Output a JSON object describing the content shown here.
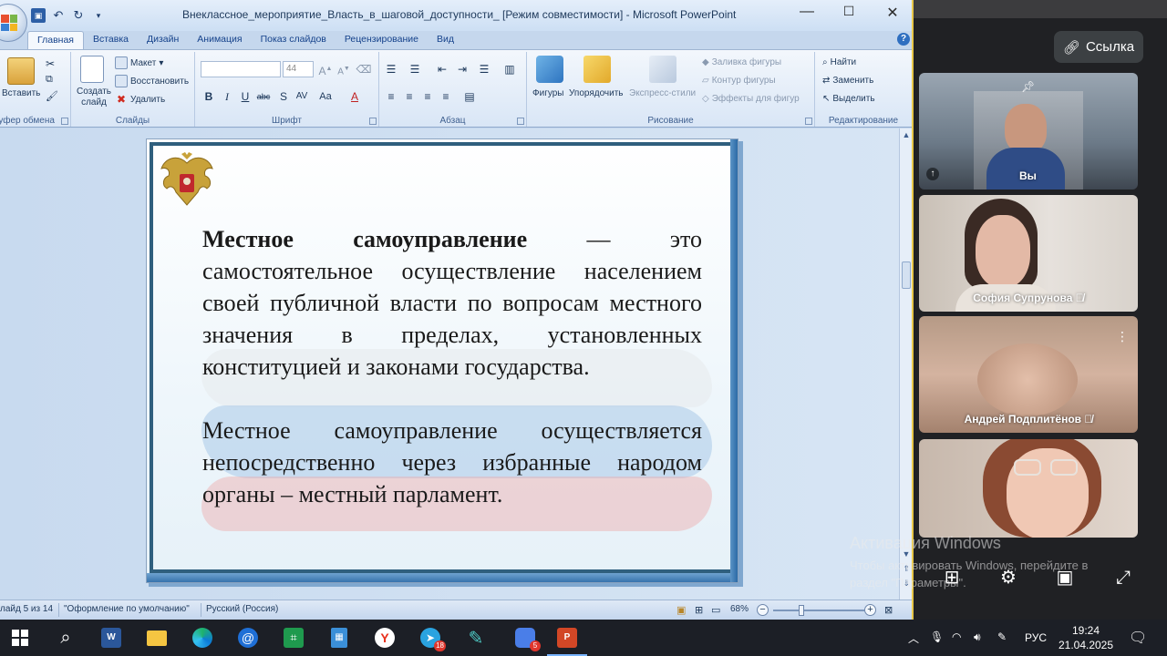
{
  "powerpoint": {
    "window_title": "Внеклассное_мероприятие_Власть_в_шаговой_доступности_ [Режим совместимости] - Microsoft PowerPoint",
    "tabs": [
      "Главная",
      "Вставка",
      "Дизайн",
      "Анимация",
      "Показ слайдов",
      "Рецензирование",
      "Вид"
    ],
    "ribbon": {
      "clipboard": {
        "paste": "Вставить",
        "label": "Буфер обмена"
      },
      "slides": {
        "new_slide": "Создать слайд",
        "layout": "Макет",
        "reset": "Восстановить",
        "delete": "Удалить",
        "label": "Слайды"
      },
      "font": {
        "size": "44",
        "label": "Шрифт"
      },
      "paragraph": {
        "label": "Абзац"
      },
      "drawing": {
        "shapes": "Фигуры",
        "arrange": "Упорядочить",
        "quick_styles": "Экспресс-стили",
        "fill": "Заливка фигуры",
        "outline": "Контур фигуры",
        "effects": "Эффекты для фигур",
        "label": "Рисование"
      },
      "editing": {
        "find": "Найти",
        "replace": "Заменить",
        "select": "Выделить",
        "label": "Редактирование"
      }
    },
    "slide": {
      "bold_term": "Местное самоуправление",
      "paragraph1": " — это самостоятельное осуществление населением своей публичной власти по вопросам местного значения в пределах, установленных конституцией и законами государства.",
      "paragraph2": "Местное самоуправление осуществляется непосредственно через избранные народом органы – местный парламент."
    },
    "status": {
      "slide_counter": "лайд 5 из 14",
      "theme": "\"Оформление по умолчанию\"",
      "language": "Русский (Россия)",
      "zoom": "68%"
    }
  },
  "meet": {
    "link_button": "Ссылка",
    "participants": [
      {
        "name": "Вы"
      },
      {
        "name": "София Супрунова"
      },
      {
        "name": "Андрей Подплитёнов"
      },
      {
        "name": ""
      }
    ],
    "activation_title": "Активация Windows",
    "activation_text": "Чтобы активировать Windows, перейдите в раздел \"Параметры\"."
  },
  "taskbar": {
    "telegram_badge": "18",
    "app_badge": "5",
    "language": "РУС",
    "time": "19:24",
    "date": "21.04.2025"
  },
  "colors": {
    "ribbon_text": "#15428b",
    "meet_bg": "#202124",
    "taskbar_bg": "#1c1f26"
  }
}
